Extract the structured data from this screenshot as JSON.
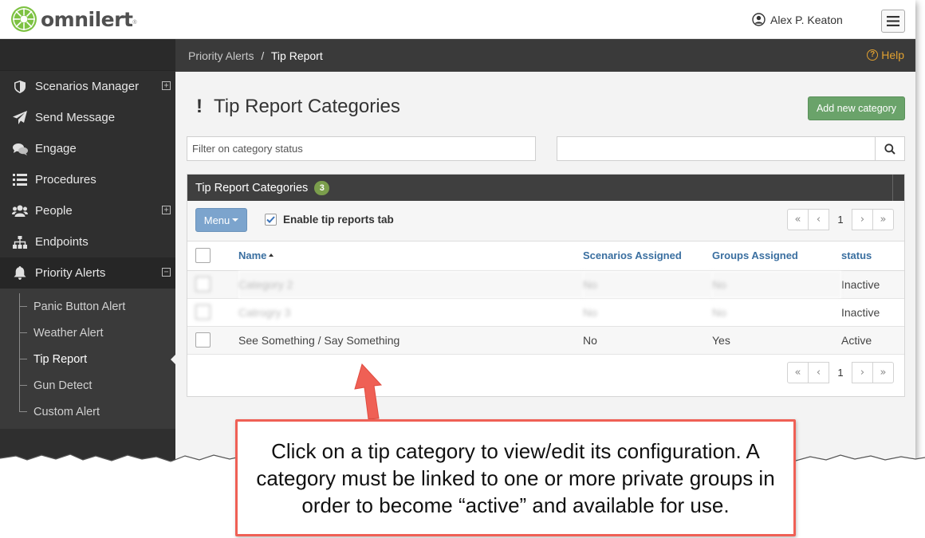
{
  "brand": {
    "name": "omnilert",
    "reg": "®"
  },
  "user": {
    "name": "Alex P. Keaton"
  },
  "sidebar": {
    "items": [
      {
        "label": "Scenarios Manager",
        "icon": "shield-icon",
        "expandable": true
      },
      {
        "label": "Send Message",
        "icon": "paper-plane-icon",
        "expandable": false
      },
      {
        "label": "Engage",
        "icon": "chat-bubbles-icon",
        "expandable": false
      },
      {
        "label": "Procedures",
        "icon": "list-icon",
        "expandable": false
      },
      {
        "label": "People",
        "icon": "users-icon",
        "expandable": true
      },
      {
        "label": "Endpoints",
        "icon": "sitemap-icon",
        "expandable": false
      },
      {
        "label": "Priority Alerts",
        "icon": "bell-icon",
        "expandable": true,
        "expanded": true
      }
    ],
    "subitems": [
      {
        "label": "Panic Button Alert"
      },
      {
        "label": "Weather Alert"
      },
      {
        "label": "Tip Report",
        "current": true
      },
      {
        "label": "Gun Detect"
      },
      {
        "label": "Custom Alert"
      }
    ]
  },
  "breadcrumb": {
    "parent": "Priority Alerts",
    "separator": "/",
    "current": "Tip Report"
  },
  "help": {
    "label": "Help"
  },
  "page": {
    "title": "Tip Report Categories",
    "add_button": "Add new category",
    "filter_placeholder": "Filter on category status",
    "search_placeholder": ""
  },
  "panel": {
    "title": "Tip Report Categories",
    "count": "3",
    "menu_label": "Menu",
    "enable_label": "Enable tip reports tab",
    "enable_checked": true,
    "pager": {
      "first": "«",
      "prev": "‹",
      "page": "1",
      "next": "›",
      "last": "»"
    },
    "columns": {
      "name": "Name",
      "scenarios": "Scenarios Assigned",
      "groups": "Groups Assigned",
      "status": "status"
    },
    "rows": [
      {
        "name": "Category 2",
        "scenarios": "No",
        "groups": "No",
        "status": "Inactive",
        "blurred": true
      },
      {
        "name": "Catrogry 3",
        "scenarios": "No",
        "groups": "No",
        "status": "Inactive",
        "blurred": true
      },
      {
        "name": "See Something / Say Something",
        "scenarios": "No",
        "groups": "Yes",
        "status": "Active",
        "blurred": false
      }
    ]
  },
  "callout": {
    "text": "Click on a tip category to view/edit its configuration. A category must be linked to one or more private groups in order to become “active” and available for use.",
    "border_color": "#ef6055"
  },
  "colors": {
    "sidebar_bg": "#2f2f2f",
    "add_button": "#6aa36a",
    "menu_button": "#7ca4cd",
    "badge": "#7b9e4c",
    "link": "#3a6fa0",
    "help": "#e0a030"
  }
}
